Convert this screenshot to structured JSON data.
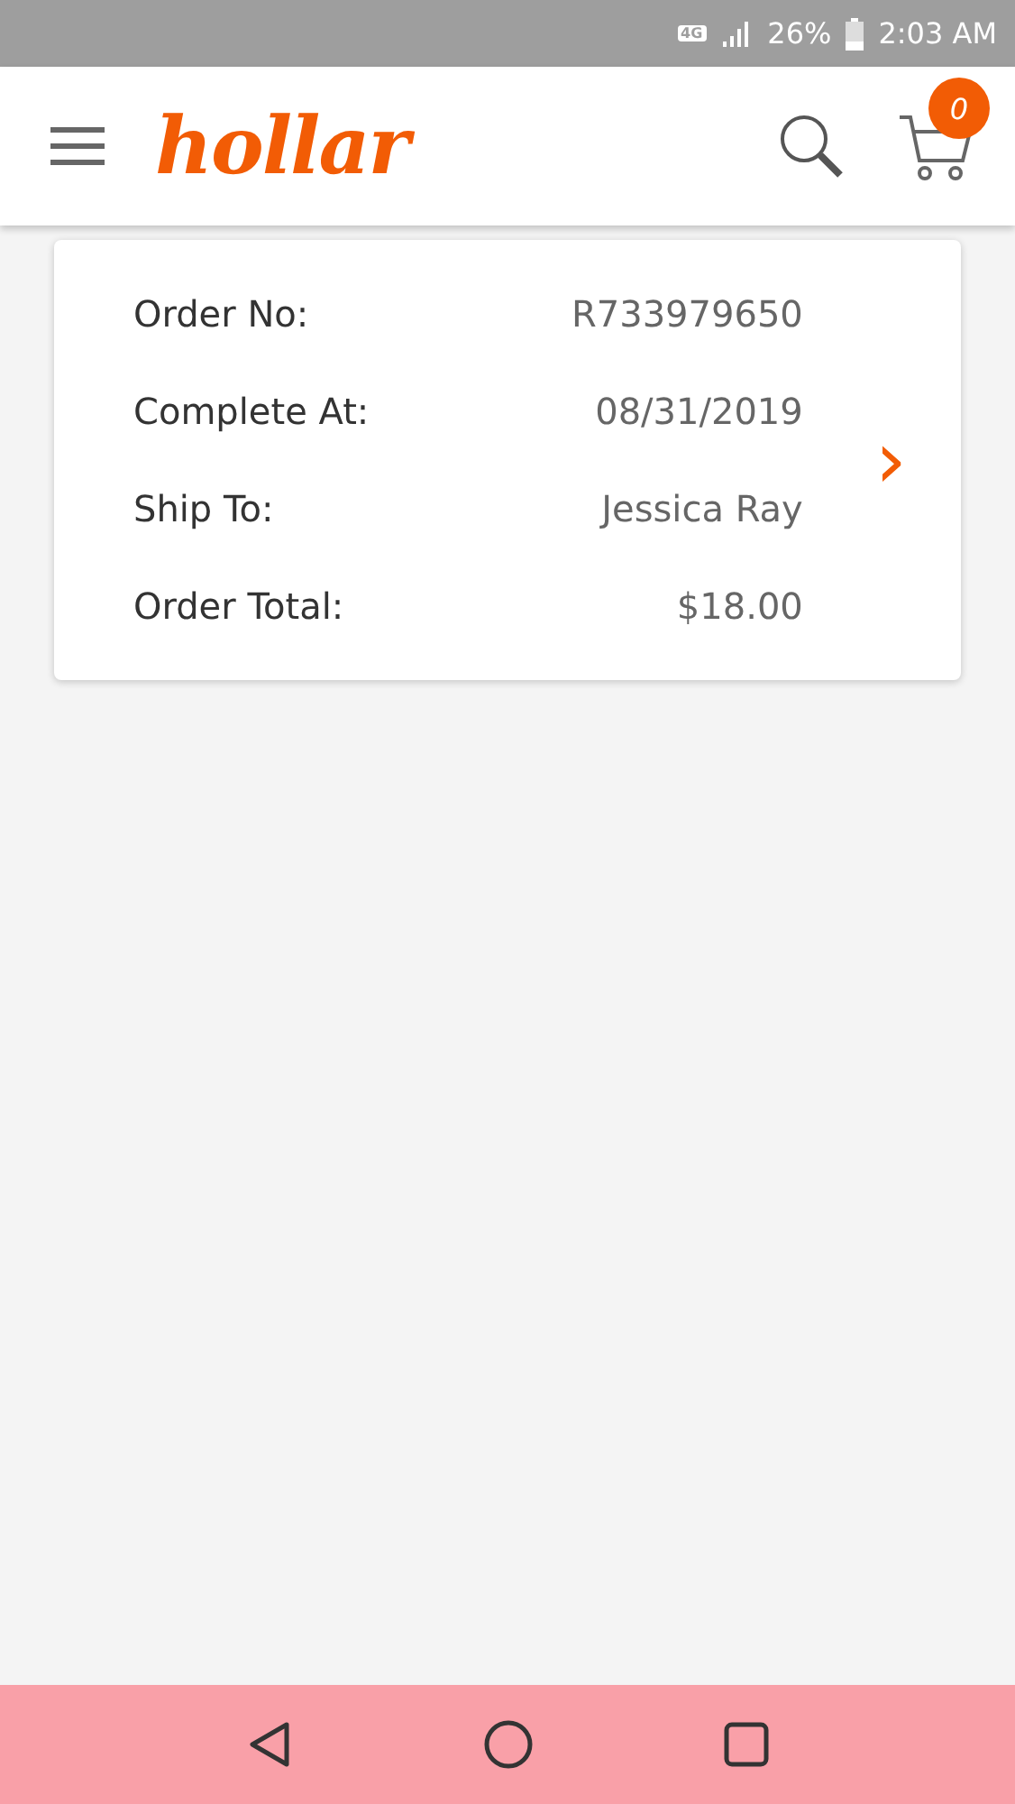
{
  "status_bar": {
    "network": "4G",
    "battery": "26%",
    "time": "2:03 AM"
  },
  "header": {
    "logo": "hollar",
    "cart_count": "0"
  },
  "orders": [
    {
      "fields": [
        {
          "label": "Order No:",
          "value": "R733979650"
        },
        {
          "label": "Complete At:",
          "value": "08/31/2019"
        },
        {
          "label": "Ship To:",
          "value": "Jessica Ray"
        },
        {
          "label": "Order Total:",
          "value": "$18.00"
        }
      ],
      "chevron": "›"
    }
  ]
}
